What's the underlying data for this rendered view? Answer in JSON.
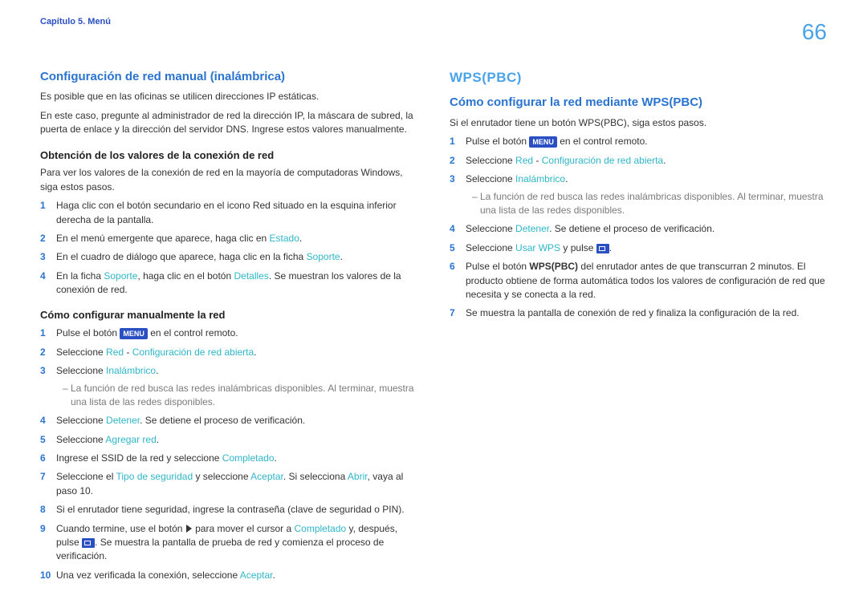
{
  "header": {
    "chapter": "Capítulo 5. Menú",
    "page_number": "66"
  },
  "words": {
    "en_el_control_remoto": " en el control remoto.",
    "seleccione": "Seleccione ",
    "dash": " - ",
    "y_pulse": " y pulse "
  },
  "left": {
    "h2": "Configuración de red manual (inalámbrica)",
    "intro1": "Es posible que en las oficinas se utilicen direcciones IP estáticas.",
    "intro2": "En este caso, pregunte al administrador de red la dirección IP, la máscara de subred, la puerta de enlace y la dirección del servidor DNS. Ingrese estos valores manualmente.",
    "subA": "Obtención de los valores de la conexión de red",
    "subA_intro": "Para ver los valores de la conexión de red en la mayoría de computadoras Windows, siga estos pasos.",
    "a1": "Haga clic con el botón secundario en el icono Red situado en la esquina inferior derecha de la pantalla.",
    "a2_pre": "En el menú emergente que aparece, haga clic en ",
    "a2_c": "Estado",
    "a2_post": ".",
    "a3_pre": "En el cuadro de diálogo que aparece, haga clic en la ficha ",
    "a3_c": "Soporte",
    "a3_post": ".",
    "a4_pre": "En la ficha ",
    "a4_c1": "Soporte",
    "a4_mid": ", haga clic en el botón ",
    "a4_c2": "Detalles",
    "a4_post": ". Se muestran los valores de la conexión de red.",
    "subB": "Cómo configurar manualmente la red",
    "b1_pre": "Pulse el botón ",
    "menu_label": "MENU",
    "b2_c1": "Red",
    "b2_c2": "Configuración de red abierta",
    "b2_post": ".",
    "b3_c": "Inalámbrico",
    "b3_post": ".",
    "b3_note": "La función de red busca las redes inalámbricas disponibles. Al terminar, muestra una lista de las redes disponibles.",
    "b4_c": "Detener",
    "b4_post": ". Se detiene el proceso de verificación.",
    "b5_c": "Agregar red",
    "b5_post": ".",
    "b6_pre": "Ingrese el SSID de la red y seleccione ",
    "b6_c": "Completado",
    "b6_post": ".",
    "b7_pre": "Seleccione el ",
    "b7_c1": "Tipo de seguridad",
    "b7_mid": " y seleccione ",
    "b7_c2": "Aceptar",
    "b7_mid2": ". Si selecciona ",
    "b7_c3": "Abrir",
    "b7_post": ", vaya al paso 10.",
    "b8": "Si el enrutador tiene seguridad, ingrese la contraseña (clave de seguridad o PIN).",
    "b9_pre": "Cuando termine, use el botón ",
    "b9_mid": " para mover el cursor a ",
    "b9_c": "Completado",
    "b9_mid2": " y, después, pulse ",
    "b9_post": ". Se muestra la pantalla de prueba de red y comienza el proceso de verificación.",
    "b10_pre": "Una vez verificada la conexión, seleccione ",
    "b10_c": "Aceptar",
    "b10_post": "."
  },
  "right": {
    "h1": "WPS(PBC)",
    "h2": "Cómo configurar la red mediante WPS(PBC)",
    "intro": "Si el enrutador tiene un botón WPS(PBC), siga estos pasos.",
    "r1_pre": "Pulse el botón ",
    "menu_label": "MENU",
    "r2_c1": "Red",
    "r2_c2": "Configuración de red abierta",
    "r2_post": ".",
    "r3_c": "Inalámbrico",
    "r3_post": ".",
    "r3_note": "La función de red busca las redes inalámbricas disponibles. Al terminar, muestra una lista de las redes disponibles.",
    "r4_c": "Detener",
    "r4_post": ". Se detiene el proceso de verificación.",
    "r5_c": "Usar WPS",
    "r5_post": ".",
    "r6_pre": "Pulse el botón ",
    "r6_bold": "WPS(PBC)",
    "r6_post": " del enrutador antes de que transcurran 2 minutos. El producto obtiene de forma automática todos los valores de configuración de red que necesita y se conecta a la red.",
    "r7": "Se muestra la pantalla de conexión de red y finaliza la configuración de la red."
  }
}
